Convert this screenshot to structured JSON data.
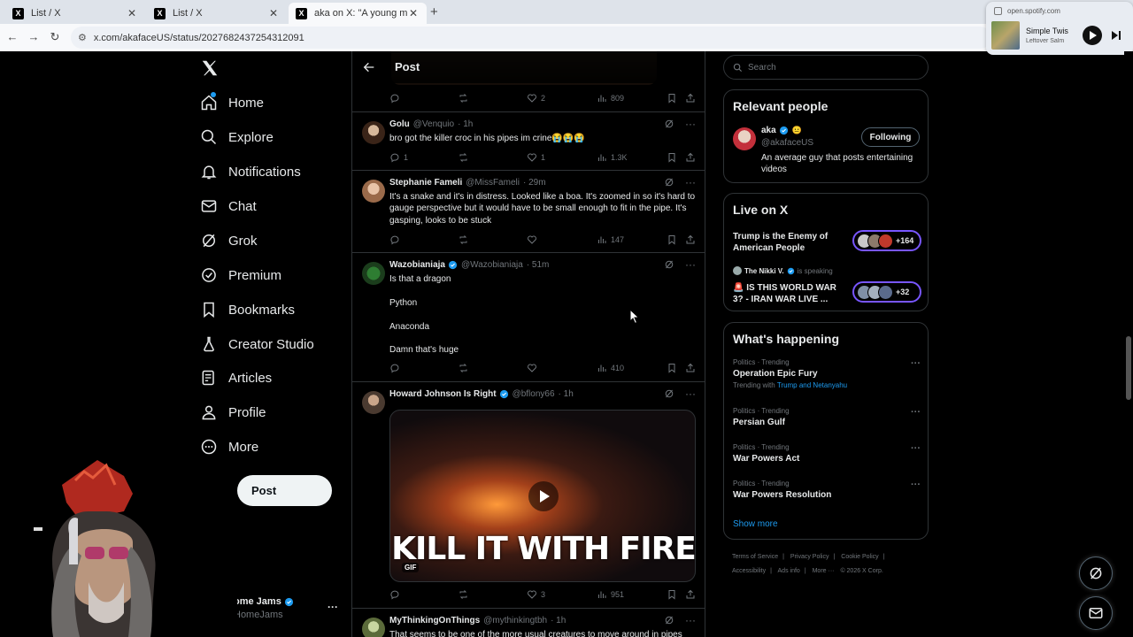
{
  "browser": {
    "tabs": [
      {
        "label": "List / X"
      },
      {
        "label": "List / X"
      },
      {
        "label": "aka on X: \"A young man strug"
      }
    ],
    "url": "x.com/akafaceUS/status/2027682437254312091"
  },
  "media_player": {
    "source": "open.spotify.com",
    "title": "Simple Twis",
    "artist": "Leftover Salm"
  },
  "nav": {
    "items": [
      {
        "label": "Home",
        "icon": "home-icon"
      },
      {
        "label": "Explore",
        "icon": "search-icon"
      },
      {
        "label": "Notifications",
        "icon": "bell-icon"
      },
      {
        "label": "Chat",
        "icon": "envelope-icon"
      },
      {
        "label": "Grok",
        "icon": "grok-icon"
      },
      {
        "label": "Premium",
        "icon": "verified-icon"
      },
      {
        "label": "Bookmarks",
        "icon": "bookmark-icon"
      },
      {
        "label": "Creator Studio",
        "icon": "flask-icon"
      },
      {
        "label": "Articles",
        "icon": "article-icon"
      },
      {
        "label": "Profile",
        "icon": "person-icon"
      },
      {
        "label": "More",
        "icon": "more-circle-icon"
      }
    ],
    "post_button": "Post",
    "account": {
      "name": "ome Jams",
      "handle": "HomeJams"
    }
  },
  "main": {
    "title": "Post",
    "first_actions": {
      "replies": "",
      "likes": "2",
      "views": "809"
    },
    "tweets": [
      {
        "name": "Golu",
        "handle": "@Venquio",
        "time": "· 1h",
        "verified": false,
        "body": "bro got the killer croc in his pipes im crine😭😭😭",
        "replies": "1",
        "retweets": "",
        "likes": "1",
        "views": "1.3K"
      },
      {
        "name": "Stephanie Fameli",
        "handle": "@MissFameli",
        "time": "· 29m",
        "verified": false,
        "body": "It's a snake and it's in distress. Looked like a boa. It's zoomed in so it's hard to gauge perspective but it would have to be small enough to fit in the pipe. It's gasping, looks to be stuck",
        "replies": "",
        "retweets": "",
        "likes": "",
        "views": "147"
      },
      {
        "name": "Wazobianiaja",
        "handle": "@Wazobianiaja",
        "time": "· 51m",
        "verified": true,
        "body_lines": [
          "Is that a dragon",
          "Python",
          "Anaconda",
          "Damn that's huge"
        ],
        "replies": "",
        "retweets": "",
        "likes": "",
        "views": "410"
      },
      {
        "name": "Howard Johnson Is Right",
        "handle": "@bflony66",
        "time": "· 1h",
        "verified": true,
        "gif_caption": "KILL IT WITH FIRE",
        "gif_tag": "GIF",
        "replies": "",
        "retweets": "",
        "likes": "3",
        "views": "951"
      },
      {
        "name": "MyThinkingOnThings",
        "handle": "@mythinkingtbh",
        "time": "· 1h",
        "verified": false,
        "body": "That seems to be one of the more usual creatures to move around in pipes"
      }
    ]
  },
  "right": {
    "search_placeholder": "Search",
    "relevant": {
      "title": "Relevant people",
      "name": "aka",
      "handle": "@akafaceUS",
      "bio": "An average guy that posts entertaining videos",
      "follow_label": "Following"
    },
    "live": {
      "title": "Live on X",
      "items": [
        {
          "title": "Trump is the Enemy of American People",
          "count": "+164"
        },
        {
          "host": "The Nikki V.",
          "status": "is speaking",
          "title": "🚨 IS THIS WORLD WAR 3? - IRAN WAR LIVE ...",
          "count": "+32"
        }
      ]
    },
    "happening": {
      "title": "What's happening",
      "trends": [
        {
          "context": "Politics · Trending",
          "name": "Operation Epic Fury",
          "with_label": "Trending with",
          "with": "Trump and Netanyahu"
        },
        {
          "context": "Politics · Trending",
          "name": "Persian Gulf"
        },
        {
          "context": "Politics · Trending",
          "name": "War Powers Act"
        },
        {
          "context": "Politics · Trending",
          "name": "War Powers Resolution"
        }
      ],
      "show_more": "Show more"
    },
    "footer": [
      "Terms of Service",
      "|",
      "Privacy Policy",
      "|",
      "Cookie Policy",
      "|",
      "Accessibility",
      "|",
      "Ads info",
      "|",
      "More ···",
      "© 2026 X Corp."
    ]
  },
  "colors": {
    "accent": "#1d9bf0",
    "background": "#000000",
    "border": "#2f3336",
    "muted": "#71767b"
  }
}
